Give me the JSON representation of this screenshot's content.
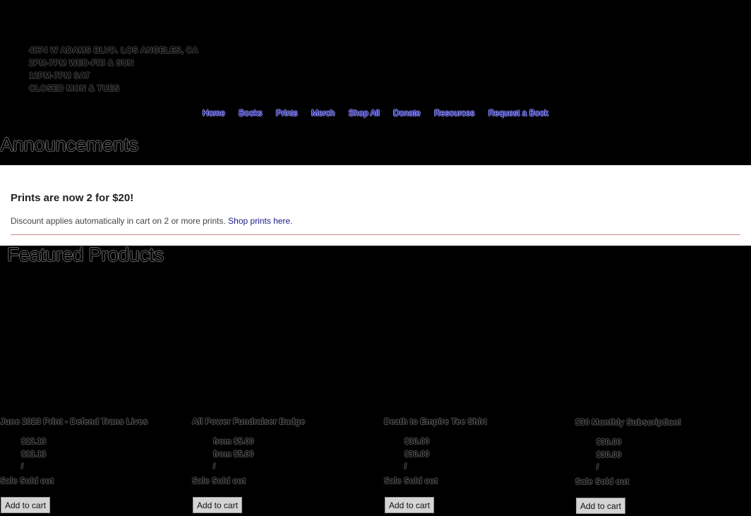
{
  "store_info": {
    "address": "4874 W ADAMS BLVD. LOS ANGELES, CA",
    "hours_1": "2PM-7PM WED-FRI & SUN",
    "hours_2": "12PM-7PM SAT",
    "hours_3": "CLOSED MON & TUES"
  },
  "nav": {
    "items": [
      "Home",
      "Books",
      "Prints",
      "Merch",
      "Shop All",
      "Donate",
      "Resources",
      "Request a Book"
    ]
  },
  "announcements": {
    "heading": "Announcements",
    "title": "Prints are now 2 for $20!",
    "text": "Discount applies automatically in cart on 2 or more prints.",
    "link_text": "Shop prints here."
  },
  "featured": {
    "heading": "Featured Products",
    "products": [
      {
        "title": "June 2023 Print - Defend Trans Lives",
        "price_1": "$13.13",
        "price_2": "$13.13",
        "slash": "/",
        "sale": "Sale Sold out",
        "button": "Add to cart"
      },
      {
        "title": "All Power Fundraiser Badge",
        "price_1": "from $5.00",
        "price_2": "from $5.00",
        "slash": "/",
        "sale": "Sale Sold out",
        "button": "Add to cart"
      },
      {
        "title": "Death to Empire Tee Shirt",
        "price_1": "$30.00",
        "price_2": "$30.00",
        "slash": "/",
        "sale": "Sale Sold out",
        "button": "Add to cart"
      },
      {
        "title": "$30 Monthly Subscription!",
        "price_1": "$30.00",
        "price_2": "$30.00",
        "slash": "/",
        "sale": "Sale Sold out",
        "button": "Add to cart"
      }
    ]
  }
}
